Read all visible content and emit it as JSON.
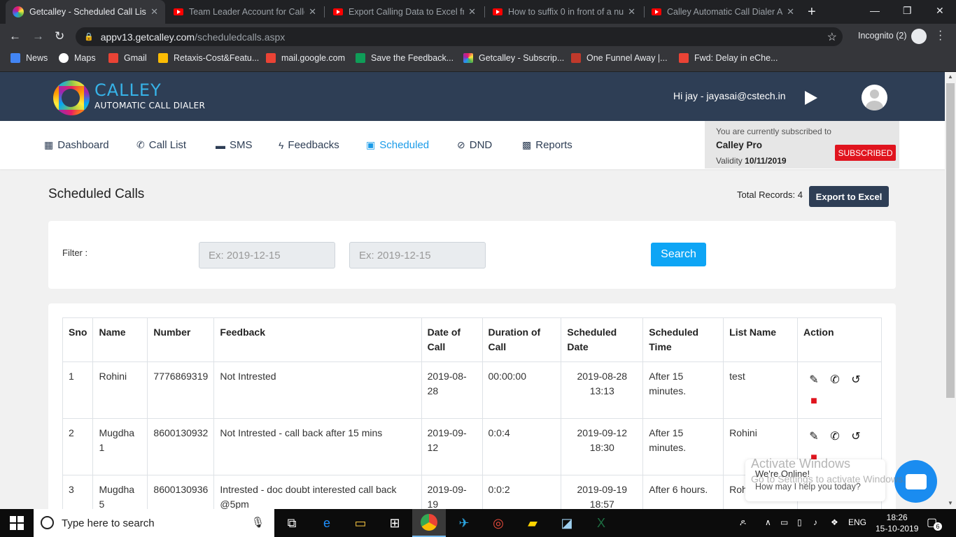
{
  "browser": {
    "tabs": [
      {
        "title": "Getcalley - Scheduled Call List",
        "active": true
      },
      {
        "title": "Team Leader Account for Calle"
      },
      {
        "title": "Export Calling Data to Excel fro"
      },
      {
        "title": "How to suffix 0 in front of a nu"
      },
      {
        "title": "Calley Automatic Call Dialer Ap"
      }
    ],
    "url_host": "appv13.getcalley.com",
    "url_path": "/scheduledcalls.aspx",
    "incognito_label": "Incognito (2)",
    "bookmarks": [
      "News",
      "Maps",
      "Gmail",
      "Retaxis-Cost&Featu...",
      "mail.google.com",
      "Save the Feedback...",
      "Getcalley - Subscrip...",
      "One Funnel Away |...",
      "Fwd: Delay in eChe..."
    ]
  },
  "header": {
    "logo_title": "CALLEY",
    "logo_subtitle": "AUTOMATIC CALL DIALER",
    "greeting": "Hi jay - jayasai@cstech.in"
  },
  "nav": {
    "items": [
      {
        "label": "Dashboard",
        "icon": "dashboard-icon"
      },
      {
        "label": "Call List",
        "icon": "phone-icon"
      },
      {
        "label": "SMS",
        "icon": "chat-icon"
      },
      {
        "label": "Feedbacks",
        "icon": "bolt-icon"
      },
      {
        "label": "Scheduled",
        "icon": "calendar-icon",
        "active": true
      },
      {
        "label": "DND",
        "icon": "block-icon"
      },
      {
        "label": "Reports",
        "icon": "grid-icon"
      }
    ]
  },
  "subscription": {
    "line1": "You are currently subscribed to",
    "plan": "Calley Pro",
    "validity_label": "Validity",
    "validity_date": "10/11/2019",
    "badge": "SUBSCRIBED"
  },
  "page": {
    "title": "Scheduled Calls",
    "total_records": "Total Records: 4",
    "export_label": "Export to Excel"
  },
  "filter": {
    "label": "Filter :",
    "from_placeholder": "Ex: 2019-12-15",
    "to_placeholder": "Ex: 2019-12-15",
    "search_label": "Search"
  },
  "table": {
    "headers": [
      "Sno",
      "Name",
      "Number",
      "Feedback",
      "Date of Call",
      "Duration of Call",
      "Scheduled Date",
      "Scheduled Time",
      "List Name",
      "Action"
    ],
    "rows": [
      {
        "sno": "1",
        "name": "Rohini",
        "number": "7776869319",
        "feedback": "Not Intrested",
        "date": "2019-08-28",
        "duration": "00:00:00",
        "sched_date": "2019-08-28 13:13",
        "sched_time": "After 15 minutes.",
        "list": "test"
      },
      {
        "sno": "2",
        "name": "Mugdha 1",
        "number": "8600130932",
        "feedback": "Not Intrested - call back after 15 mins",
        "date": "2019-09-12",
        "duration": "0:0:4",
        "sched_date": "2019-09-12 18:30",
        "sched_time": "After 15 minutes.",
        "list": "Rohini"
      },
      {
        "sno": "3",
        "name": "Mugdha 5",
        "number": "8600130936",
        "feedback": "Intrested - doc doubt interested call back @5pm",
        "date": "2019-09-19",
        "duration": "0:0:2",
        "sched_date": "2019-09-19 18:57",
        "sched_time": "After 6 hours.",
        "list": "Roh"
      }
    ]
  },
  "chat": {
    "line1": "We're Online!",
    "line2": "How may I help you today?"
  },
  "watermark": {
    "line1": "Activate Windows",
    "line2": "Go to Settings to activate Windows."
  },
  "taskbar": {
    "search_placeholder": "Type here to search",
    "lang": "ENG",
    "time": "18:26",
    "date": "15-10-2019",
    "notifications": "6"
  }
}
